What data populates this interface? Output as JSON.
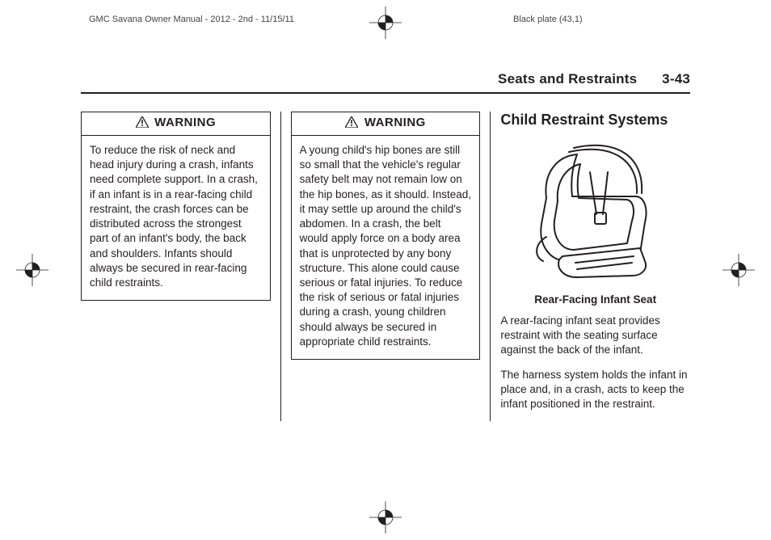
{
  "running_header": {
    "left": "GMC Savana Owner Manual - 2012 - 2nd - 11/15/11",
    "right": "Black plate (43,1)"
  },
  "section_header": {
    "title": "Seats and Restraints",
    "page": "3-43"
  },
  "columns": {
    "col1": {
      "warning_label": "WARNING",
      "warning_body": "To reduce the risk of neck and head injury during a crash, infants need complete support. In a crash, if an infant is in a rear-facing child restraint, the crash forces can be distributed across the strongest part of an infant's body, the back and shoulders. Infants should always be secured in rear-facing child restraints."
    },
    "col2": {
      "warning_label": "WARNING",
      "warning_body": "A young child's hip bones are still so small that the vehicle's regular safety belt may not remain low on the hip bones, as it should. Instead, it may settle up around the child's abdomen. In a crash, the belt would apply force on a body area that is unprotected by any bony structure. This alone could cause serious or fatal injuries. To reduce the risk of serious or fatal injuries during a crash, young children should always be secured in appropriate child restraints."
    },
    "col3": {
      "heading": "Child Restraint Systems",
      "caption": "Rear-Facing Infant Seat",
      "para1": "A rear-facing infant seat provides restraint with the seating surface against the back of the infant.",
      "para2": "The harness system holds the infant in place and, in a crash, acts to keep the infant positioned in the restraint."
    }
  }
}
